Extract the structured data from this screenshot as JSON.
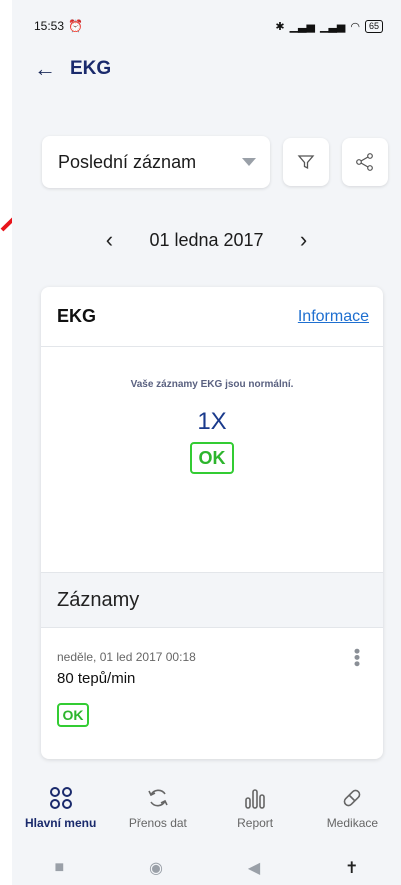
{
  "status": {
    "time": "15:53",
    "battery": "65"
  },
  "header": {
    "title": "EKG"
  },
  "filter": {
    "selected": "Poslední záznam"
  },
  "date_nav": {
    "date": "01 ledna 2017"
  },
  "card": {
    "title": "EKG",
    "info_link": "Informace",
    "summary_text": "Vaše záznamy EKG jsou normální.",
    "summary_count": "1X",
    "summary_badge": "OK",
    "records_title": "Záznamy",
    "records": [
      {
        "datetime": "neděle, 01 led 2017 00:18",
        "value": "80 tepů/min",
        "badge": "OK"
      }
    ]
  },
  "bottom_nav": [
    {
      "label": "Hlavní menu",
      "icon": "grid-icon"
    },
    {
      "label": "Přenos dat",
      "icon": "sync-icon"
    },
    {
      "label": "Report",
      "icon": "report-icon"
    },
    {
      "label": "Medikace",
      "icon": "pill-icon"
    }
  ],
  "colors": {
    "accent": "#1a2a6c",
    "ok": "#33cc33",
    "link": "#1e6fd0",
    "annotation": "#e8141b"
  }
}
